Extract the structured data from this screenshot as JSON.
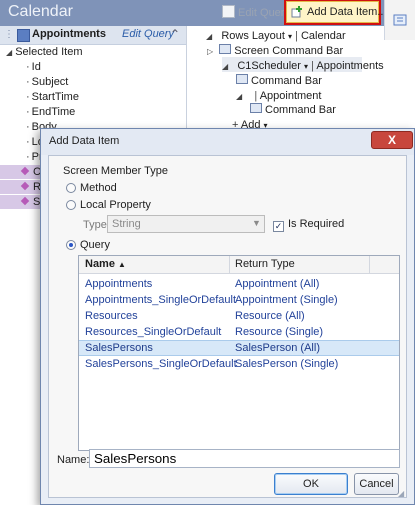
{
  "window": {
    "title": "Calendar"
  },
  "toolbar": {
    "edit_query": "Edit Query",
    "add_data_item": "Add Data Item..."
  },
  "left_panel": {
    "header": "Appointments",
    "edit_query": "Edit Query",
    "selected_item": "Selected Item",
    "properties": [
      "Id",
      "Subject",
      "StartTime",
      "EndTime",
      "Body",
      "Lo",
      "Pr"
    ],
    "collapsed": [
      "Cl",
      "Re",
      "Sa"
    ]
  },
  "right_panel": {
    "rows_layout": "Rows Layout",
    "calendar": "Calendar",
    "screen_command_bar": "Screen Command Bar",
    "c1scheduler": "C1Scheduler",
    "appointments": "Appointments",
    "command_bar_1": "Command Bar",
    "appointment": "Appointment",
    "command_bar_2": "Command Bar",
    "add": "Add"
  },
  "dialog": {
    "title": "Add Data Item",
    "close": "X",
    "group_label": "Screen Member Type",
    "options": {
      "method": "Method",
      "local_property": "Local Property",
      "query": "Query"
    },
    "selected_option": "query",
    "type_label": "Type:",
    "type_value": "String",
    "is_required_label": "Is Required",
    "is_required_checked": true,
    "grid": {
      "columns": {
        "name": "Name",
        "sort_indicator": "▲",
        "return_type": "Return Type"
      },
      "rows": [
        {
          "name": "Appointments",
          "return_type": "Appointment (All)"
        },
        {
          "name": "Appointments_SingleOrDefault",
          "return_type": "Appointment (Single)"
        },
        {
          "name": "Resources",
          "return_type": "Resource (All)"
        },
        {
          "name": "Resources_SingleOrDefault",
          "return_type": "Resource (Single)"
        },
        {
          "name": "SalesPersons",
          "return_type": "SalesPerson (All)"
        },
        {
          "name": "SalesPersons_SingleOrDefault",
          "return_type": "SalesPerson (Single)"
        }
      ],
      "selected_index": 4
    },
    "name_label": "Name:",
    "name_value": "SalesPersons",
    "ok": "OK",
    "cancel": "Cancel"
  },
  "colors": {
    "highlight": "#d01010",
    "selection": "#d7e8f8",
    "titlebar": "#7f93b8"
  }
}
